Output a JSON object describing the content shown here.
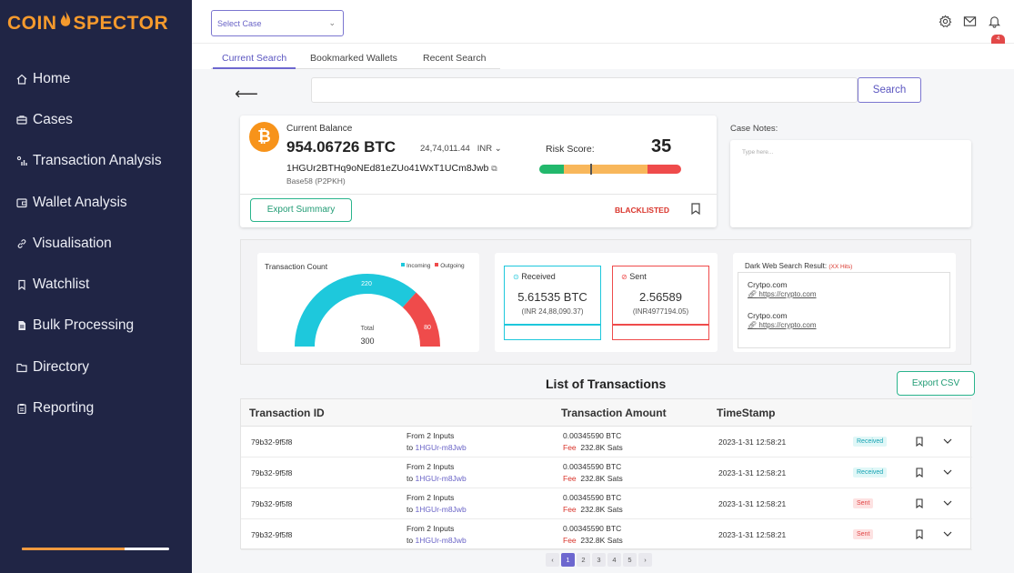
{
  "brand": {
    "left": "COIN",
    "right": "SPECTOR",
    "accent": "#f59a2d"
  },
  "sidebar": {
    "items": [
      {
        "label": "Home",
        "icon": "home-icon"
      },
      {
        "label": "Cases",
        "icon": "cases-icon"
      },
      {
        "label": "Transaction Analysis",
        "icon": "transaction-analysis-icon"
      },
      {
        "label": "Wallet Analysis",
        "icon": "wallet-icon"
      },
      {
        "label": "Visualisation",
        "icon": "link-icon"
      },
      {
        "label": "Watchlist",
        "icon": "bookmark-icon"
      },
      {
        "label": "Bulk Processing",
        "icon": "document-icon"
      },
      {
        "label": "Directory",
        "icon": "folder-icon"
      },
      {
        "label": "Reporting",
        "icon": "clipboard-icon"
      }
    ],
    "progress": 0.7
  },
  "topbar": {
    "case_select": "Select Case",
    "notification_count": "4"
  },
  "tabs": [
    "Current Search",
    "Bookmarked Wallets",
    "Recent Search"
  ],
  "search": {
    "button": "Search",
    "value": ""
  },
  "balance": {
    "label": "Current Balance",
    "value": "954.06726 BTC",
    "inr": "24,74,011.44",
    "currency": "INR",
    "address": "1HGUr2BTHq9oNEd81eZUo41WxT1UCm8Jwb",
    "address_type": "Base58 (P2PKH)",
    "risk_label": "Risk Score:",
    "risk_score": "35",
    "export_button": "Export Summary",
    "status": "BLACKLISTED"
  },
  "case_notes": {
    "label": "Case Notes:",
    "placeholder": "Type here..."
  },
  "tx_count": {
    "title": "Transaction Count",
    "legend_in": "Incoming",
    "legend_out": "Outgoing",
    "incoming": "220",
    "outgoing": "80",
    "total_label": "Total",
    "total": "300",
    "colors": {
      "incoming": "#1ec8dc",
      "outgoing": "#ef4b4b"
    }
  },
  "received": {
    "label": "Received",
    "btc": "5.61535 BTC",
    "inr": "(INR 24,88,090.37)"
  },
  "sent": {
    "label": "Sent",
    "btc": "2.56589",
    "inr": "(INR4977194.05)"
  },
  "dark_web": {
    "title": "Dark Web Search Result:",
    "hits": "(XX Hits)",
    "results": [
      {
        "name": "Crytpo.com",
        "link": "https://crypto.com"
      },
      {
        "name": "Crytpo.com",
        "link": "https://crypto.com"
      }
    ]
  },
  "transactions": {
    "title": "List of Transactions",
    "export_button": "Export CSV",
    "headers": [
      "Transaction ID",
      "Transaction Amount",
      "TimeStamp"
    ],
    "rows": [
      {
        "id": "79b32-9f5f8",
        "from": "From 2 Inputs",
        "to_label": "to",
        "to": "1HGUr-m8Jwb",
        "amount": "0.00345590  BTC",
        "fee_label": "Fee",
        "fee": "232.8K Sats",
        "time": "2023-1-31 12:58:21",
        "status": "Received"
      },
      {
        "id": "79b32-9f5f8",
        "from": "From 2 Inputs",
        "to_label": "to",
        "to": "1HGUr-m8Jwb",
        "amount": "0.00345590  BTC",
        "fee_label": "Fee",
        "fee": "232.8K Sats",
        "time": "2023-1-31 12:58:21",
        "status": "Received"
      },
      {
        "id": "79b32-9f5f8",
        "from": "From 2 Inputs",
        "to_label": "to",
        "to": "1HGUr-m8Jwb",
        "amount": "0.00345590  BTC",
        "fee_label": "Fee",
        "fee": "232.8K Sats",
        "time": "2023-1-31 12:58:21",
        "status": "Sent"
      },
      {
        "id": "79b32-9f5f8",
        "from": "From 2 Inputs",
        "to_label": "to",
        "to": "1HGUr-m8Jwb",
        "amount": "0.00345590  BTC",
        "fee_label": "Fee",
        "fee": "232.8K Sats",
        "time": "2023-1-31 12:58:21",
        "status": "Sent"
      }
    ]
  },
  "pagination": {
    "prev": "‹",
    "pages": [
      "1",
      "2",
      "3",
      "4",
      "5"
    ],
    "next": "›",
    "current": "1"
  }
}
